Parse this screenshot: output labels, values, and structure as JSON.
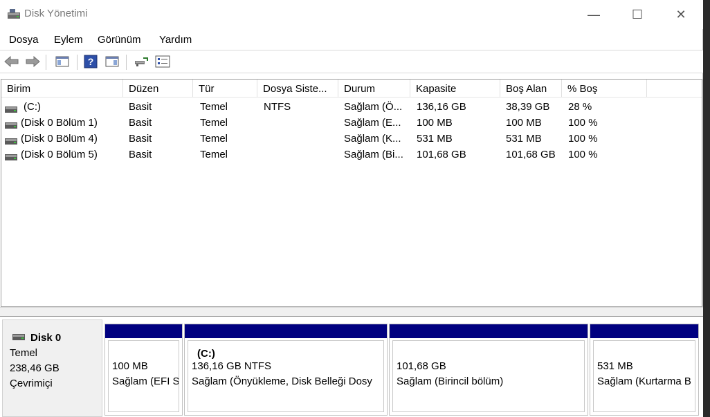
{
  "window": {
    "title": "Disk Yönetimi",
    "icon": "disk-management-icon"
  },
  "caption_buttons": {
    "minimize": "—",
    "maximize": "☐",
    "close": "✕"
  },
  "menu": [
    "Dosya",
    "Eylem",
    "Görünüm",
    "Yardım"
  ],
  "toolbar": [
    "back-arrow-icon",
    "forward-arrow-icon",
    "console-tree-icon",
    "help-icon",
    "action-pane-icon",
    "connect-icon",
    "properties-icon"
  ],
  "table": {
    "columns": [
      "Birim",
      "Düzen",
      "Tür",
      "Dosya Siste...",
      "Durum",
      "Kapasite",
      "Boş Alan",
      "% Boş"
    ],
    "rows": [
      [
        "(C:)",
        "Basit",
        "Temel",
        "NTFS",
        "Sağlam (Ö...",
        "136,16 GB",
        "38,39 GB",
        "28 %"
      ],
      [
        "(Disk 0 Bölüm 1)",
        "Basit",
        "Temel",
        "",
        "Sağlam (E...",
        "100 MB",
        "100 MB",
        "100 %"
      ],
      [
        "(Disk 0 Bölüm 4)",
        "Basit",
        "Temel",
        "",
        "Sağlam (K...",
        "531 MB",
        "531 MB",
        "100 %"
      ],
      [
        "(Disk 0 Bölüm 5)",
        "Basit",
        "Temel",
        "",
        "Sağlam (Bi...",
        "101,68 GB",
        "101,68 GB",
        "100 %"
      ]
    ]
  },
  "disk": {
    "name": "Disk 0",
    "type": "Temel",
    "size": "238,46 GB",
    "status": "Çevrimiçi"
  },
  "partitions": [
    {
      "title": "",
      "size": "100 MB",
      "status": "Sağlam (EFI S"
    },
    {
      "title": "(C:)",
      "size": "136,16 GB NTFS",
      "status": "Sağlam (Önyükleme, Disk Belleği Dosy"
    },
    {
      "title": "",
      "size": "101,68 GB",
      "status": "Sağlam (Birincil bölüm)"
    },
    {
      "title": "",
      "size": "531 MB",
      "status": "Sağlam (Kurtarma B"
    }
  ],
  "colors": {
    "partition_bar": "#000080",
    "desktop": "#2b2b2b"
  }
}
